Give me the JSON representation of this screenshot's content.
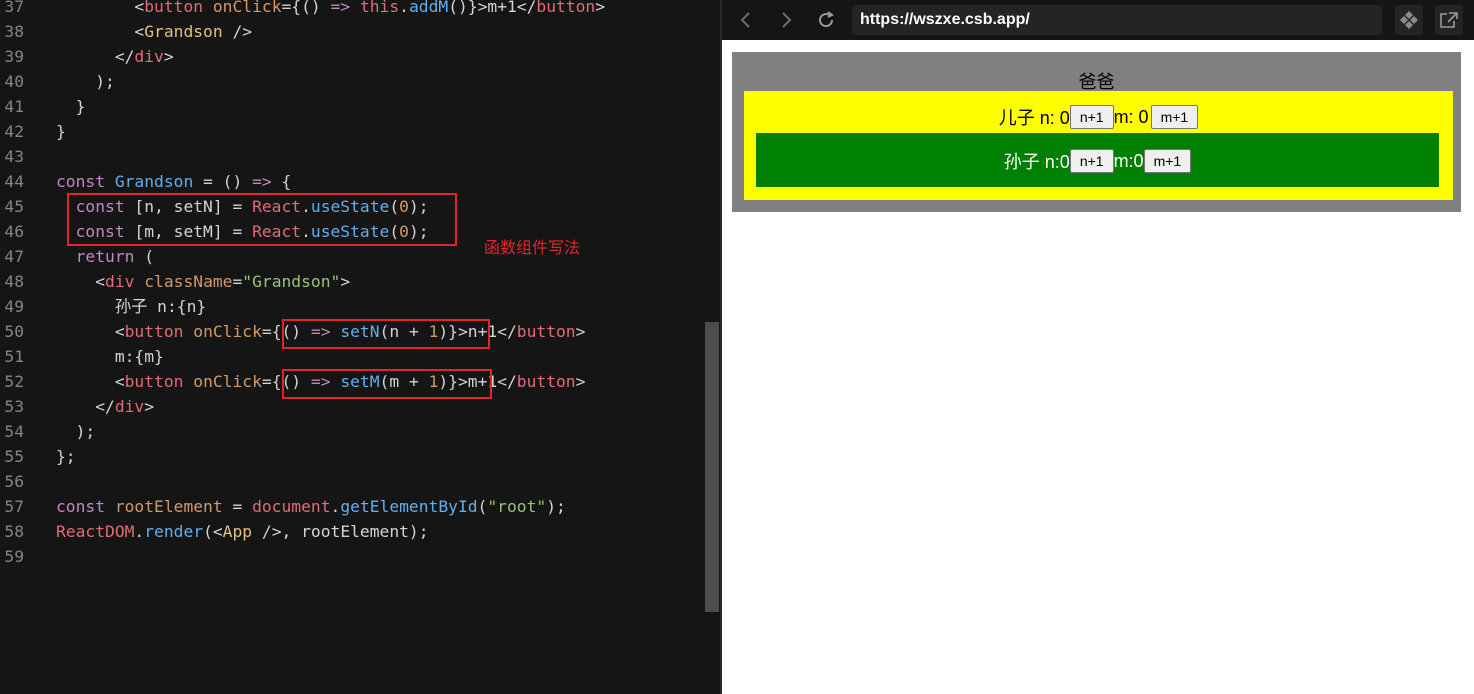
{
  "editor": {
    "lines": [
      {
        "num": "37",
        "tokens": [
          {
            "t": "        <",
            "c": ""
          },
          {
            "t": "button",
            "c": "t"
          },
          {
            "t": " ",
            "c": ""
          },
          {
            "t": "onClick",
            "c": "a"
          },
          {
            "t": "={() ",
            "c": ""
          },
          {
            "t": "=>",
            "c": "k"
          },
          {
            "t": " ",
            "c": ""
          },
          {
            "t": "this",
            "c": "t"
          },
          {
            "t": ".",
            "c": ""
          },
          {
            "t": "addM",
            "c": "f"
          },
          {
            "t": "()}>m+1</",
            "c": ""
          },
          {
            "t": "button",
            "c": "t"
          },
          {
            "t": ">",
            "c": ""
          }
        ]
      },
      {
        "num": "38",
        "tokens": [
          {
            "t": "        <",
            "c": ""
          },
          {
            "t": "Grandson",
            "c": "j"
          },
          {
            "t": " />",
            "c": ""
          }
        ]
      },
      {
        "num": "39",
        "tokens": [
          {
            "t": "      </",
            "c": ""
          },
          {
            "t": "div",
            "c": "t"
          },
          {
            "t": ">",
            "c": ""
          }
        ]
      },
      {
        "num": "40",
        "tokens": [
          {
            "t": "    );",
            "c": ""
          }
        ]
      },
      {
        "num": "41",
        "tokens": [
          {
            "t": "  }",
            "c": ""
          }
        ]
      },
      {
        "num": "42",
        "tokens": [
          {
            "t": "}",
            "c": ""
          }
        ]
      },
      {
        "num": "43",
        "tokens": []
      },
      {
        "num": "44",
        "tokens": [
          {
            "t": "const",
            "c": "k"
          },
          {
            "t": " ",
            "c": ""
          },
          {
            "t": "Grandson",
            "c": "f"
          },
          {
            "t": " = () ",
            "c": ""
          },
          {
            "t": "=>",
            "c": "k"
          },
          {
            "t": " {",
            "c": ""
          }
        ]
      },
      {
        "num": "45",
        "tokens": [
          {
            "t": "  ",
            "c": ""
          },
          {
            "t": "const",
            "c": "k"
          },
          {
            "t": " [n, setN] = ",
            "c": ""
          },
          {
            "t": "React",
            "c": "t"
          },
          {
            "t": ".",
            "c": ""
          },
          {
            "t": "useState",
            "c": "f"
          },
          {
            "t": "(",
            "c": ""
          },
          {
            "t": "0",
            "c": "n"
          },
          {
            "t": ");",
            "c": ""
          }
        ]
      },
      {
        "num": "46",
        "tokens": [
          {
            "t": "  ",
            "c": ""
          },
          {
            "t": "const",
            "c": "k"
          },
          {
            "t": " [m, setM] = ",
            "c": ""
          },
          {
            "t": "React",
            "c": "t"
          },
          {
            "t": ".",
            "c": ""
          },
          {
            "t": "useState",
            "c": "f"
          },
          {
            "t": "(",
            "c": ""
          },
          {
            "t": "0",
            "c": "n"
          },
          {
            "t": ");",
            "c": ""
          }
        ]
      },
      {
        "num": "47",
        "tokens": [
          {
            "t": "  ",
            "c": ""
          },
          {
            "t": "return",
            "c": "k"
          },
          {
            "t": " (",
            "c": ""
          }
        ]
      },
      {
        "num": "48",
        "tokens": [
          {
            "t": "    <",
            "c": ""
          },
          {
            "t": "div",
            "c": "t"
          },
          {
            "t": " ",
            "c": ""
          },
          {
            "t": "className",
            "c": "a"
          },
          {
            "t": "=",
            "c": ""
          },
          {
            "t": "\"Grandson\"",
            "c": "s"
          },
          {
            "t": ">",
            "c": ""
          }
        ]
      },
      {
        "num": "49",
        "tokens": [
          {
            "t": "      孙子 n:{n}",
            "c": ""
          }
        ]
      },
      {
        "num": "50",
        "tokens": [
          {
            "t": "      <",
            "c": ""
          },
          {
            "t": "button",
            "c": "t"
          },
          {
            "t": " ",
            "c": ""
          },
          {
            "t": "onClick",
            "c": "a"
          },
          {
            "t": "={() ",
            "c": ""
          },
          {
            "t": "=>",
            "c": "k"
          },
          {
            "t": " ",
            "c": ""
          },
          {
            "t": "setN",
            "c": "f"
          },
          {
            "t": "(n + ",
            "c": ""
          },
          {
            "t": "1",
            "c": "n"
          },
          {
            "t": ")}>n+1</",
            "c": ""
          },
          {
            "t": "button",
            "c": "t"
          },
          {
            "t": ">",
            "c": ""
          }
        ]
      },
      {
        "num": "51",
        "tokens": [
          {
            "t": "      m:{m}",
            "c": ""
          }
        ]
      },
      {
        "num": "52",
        "tokens": [
          {
            "t": "      <",
            "c": ""
          },
          {
            "t": "button",
            "c": "t"
          },
          {
            "t": " ",
            "c": ""
          },
          {
            "t": "onClick",
            "c": "a"
          },
          {
            "t": "={() ",
            "c": ""
          },
          {
            "t": "=>",
            "c": "k"
          },
          {
            "t": " ",
            "c": ""
          },
          {
            "t": "setM",
            "c": "f"
          },
          {
            "t": "(m + ",
            "c": ""
          },
          {
            "t": "1",
            "c": "n"
          },
          {
            "t": ")}>m+1</",
            "c": ""
          },
          {
            "t": "button",
            "c": "t"
          },
          {
            "t": ">",
            "c": ""
          }
        ]
      },
      {
        "num": "53",
        "tokens": [
          {
            "t": "    </",
            "c": ""
          },
          {
            "t": "div",
            "c": "t"
          },
          {
            "t": ">",
            "c": ""
          }
        ]
      },
      {
        "num": "54",
        "tokens": [
          {
            "t": "  );",
            "c": ""
          }
        ]
      },
      {
        "num": "55",
        "tokens": [
          {
            "t": "};",
            "c": ""
          }
        ]
      },
      {
        "num": "56",
        "tokens": []
      },
      {
        "num": "57",
        "tokens": [
          {
            "t": "const",
            "c": "k"
          },
          {
            "t": " ",
            "c": ""
          },
          {
            "t": "rootElement",
            "c": "a"
          },
          {
            "t": " = ",
            "c": ""
          },
          {
            "t": "document",
            "c": "t"
          },
          {
            "t": ".",
            "c": ""
          },
          {
            "t": "getElementById",
            "c": "f"
          },
          {
            "t": "(",
            "c": ""
          },
          {
            "t": "\"root\"",
            "c": "s"
          },
          {
            "t": ");",
            "c": ""
          }
        ]
      },
      {
        "num": "58",
        "tokens": [
          {
            "t": "ReactDOM",
            "c": "t"
          },
          {
            "t": ".",
            "c": ""
          },
          {
            "t": "render",
            "c": "f"
          },
          {
            "t": "(<",
            "c": ""
          },
          {
            "t": "App",
            "c": "j"
          },
          {
            "t": " />, rootElement);",
            "c": ""
          }
        ]
      },
      {
        "num": "59",
        "tokens": []
      }
    ],
    "annotation": "函数组件写法"
  },
  "browser": {
    "back_icon": "chevron-left-icon",
    "forward_icon": "chevron-right-icon",
    "reload_icon": "reload-icon",
    "url": "https://wszxe.csb.app/",
    "extension_icon": "puzzle-icon",
    "open_icon": "external-link-icon"
  },
  "app": {
    "parent_title": "爸爸",
    "son": {
      "n_label": "儿子 n: 0",
      "n_button": "n+1",
      "m_label": "m: 0",
      "m_button": "m+1"
    },
    "grandson": {
      "n_label": "孙子 n:0",
      "n_button": "n+1",
      "m_label": "m:0",
      "m_button": "m+1"
    }
  },
  "colors": {
    "editor_bg": "#151515",
    "highlight": "#e0262b",
    "parent_bg": "#808080",
    "son_bg": "#ffff00",
    "grandson_bg": "#008000"
  }
}
